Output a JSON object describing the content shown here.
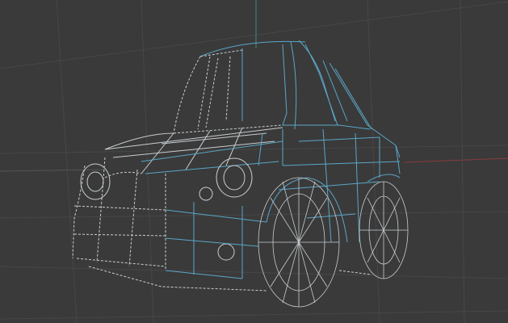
{
  "viewport": {
    "mode": "wireframe",
    "subject": "car",
    "colors": {
      "background": "#3a3a3a",
      "grid": "#4a4a4a",
      "grid_major": "#525252",
      "axis_x": "#8a3a3a",
      "axis_y": "#3f8a8a",
      "wire_light": "#c8cdd0",
      "wire_selected": "#5aa6c8"
    }
  }
}
